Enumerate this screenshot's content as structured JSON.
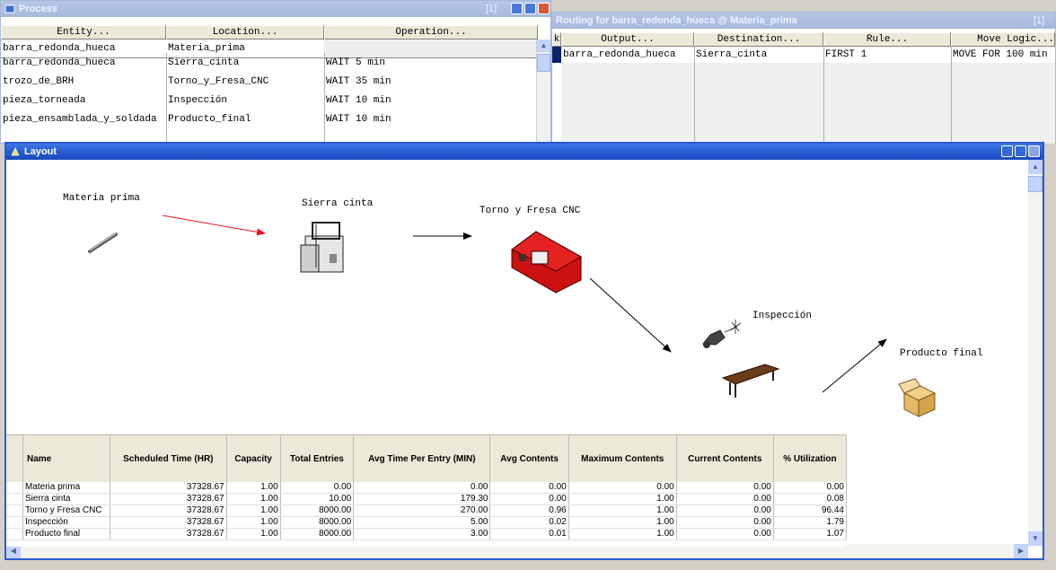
{
  "process": {
    "title": "Process",
    "count": "[1]",
    "headers": [
      "Entity...",
      "Location...",
      "Operation..."
    ],
    "first_row": {
      "entity": "barra_redonda_hueca",
      "location": "Materia_prima"
    },
    "rows": [
      {
        "entity": "barra_redonda_hueca",
        "location": "Sierra_cinta",
        "operation": "WAIT 5 min"
      },
      {
        "entity": "trozo_de_BRH",
        "location": "Torno_y_Fresa_CNC",
        "operation": "WAIT 35 min"
      },
      {
        "entity": "pieza_torneada",
        "location": "Inspección",
        "operation": "WAIT 10 min"
      },
      {
        "entity": "pieza_ensamblada_y_soldada",
        "location": "Producto_final",
        "operation": "WAIT 10 min"
      }
    ]
  },
  "routing": {
    "title": "Routing for barra_redonda_hueca @ Materia_prima",
    "count": "[1]",
    "blk_label": "k",
    "headers": [
      "Output...",
      "Destination...",
      "Rule...",
      "Move Logic..."
    ],
    "rows": [
      {
        "output": "barra_redonda_hueca",
        "destination": "Sierra_cinta",
        "rule": "FIRST 1",
        "move": "MOVE FOR 100 min"
      }
    ]
  },
  "layout": {
    "title": "Layout",
    "labels": {
      "materia": "Materia prima",
      "sierra": "Sierra cinta",
      "torno": "Torno y Fresa CNC",
      "inspeccion": "Inspección",
      "producto": "Producto final"
    },
    "colors": {
      "route_arrow": "#e8141c",
      "path_arrow": "#000000",
      "machine": "#cc1111"
    }
  },
  "stats": {
    "headers": [
      "Name",
      "Scheduled Time (HR)",
      "Capacity",
      "Total Entries",
      "Avg Time Per Entry (MIN)",
      "Avg Contents",
      "Maximum Contents",
      "Current Contents",
      "% Utilization"
    ],
    "rows": [
      [
        "Materia prima",
        "37328.67",
        "1.00",
        "0.00",
        "0.00",
        "0.00",
        "0.00",
        "0.00",
        "0.00"
      ],
      [
        "Sierra cinta",
        "37328.67",
        "1.00",
        "10.00",
        "179.30",
        "0.00",
        "1.00",
        "0.00",
        "0.08"
      ],
      [
        "Torno y Fresa CNC",
        "37328.67",
        "1.00",
        "8000.00",
        "270.00",
        "0.96",
        "1.00",
        "0.00",
        "96.44"
      ],
      [
        "Inspección",
        "37328.67",
        "1.00",
        "8000.00",
        "5.00",
        "0.02",
        "1.00",
        "0.00",
        "1.79"
      ],
      [
        "Producto final",
        "37328.67",
        "1.00",
        "8000.00",
        "3.00",
        "0.01",
        "1.00",
        "0.00",
        "1.07"
      ]
    ]
  }
}
